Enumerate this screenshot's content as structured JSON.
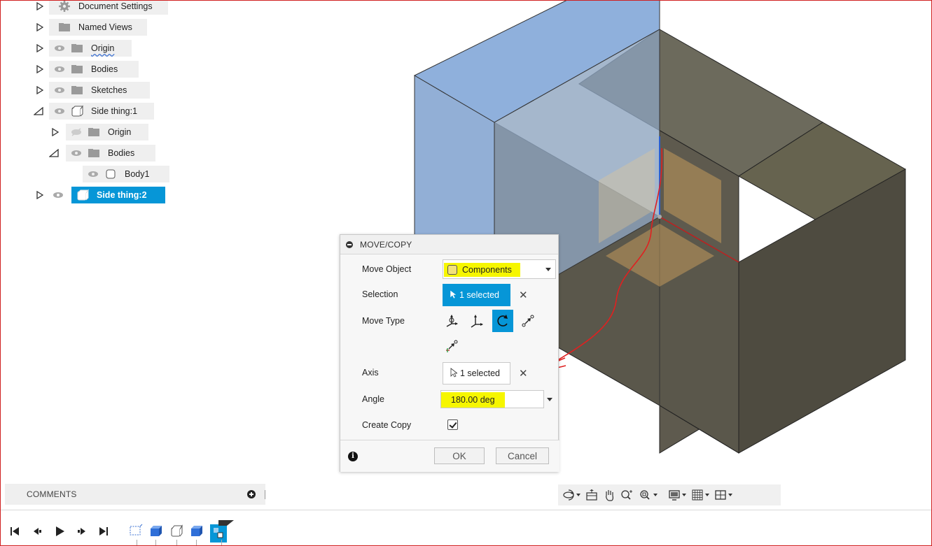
{
  "browser": {
    "items": [
      {
        "label": "Document Settings",
        "icon": "gear-icon"
      },
      {
        "label": "Named Views",
        "icon": "folder-icon"
      },
      {
        "label": "Origin",
        "icon": "folder-icon"
      },
      {
        "label": "Bodies",
        "icon": "folder-icon"
      },
      {
        "label": "Sketches",
        "icon": "folder-icon"
      },
      {
        "label": "Side thing:1",
        "icon": "component-icon"
      },
      {
        "label": "Origin",
        "icon": "folder-icon"
      },
      {
        "label": "Bodies",
        "icon": "folder-icon"
      },
      {
        "label": "Body1",
        "icon": "body-icon"
      },
      {
        "label": "Side thing:2",
        "icon": "component-icon",
        "selected": true
      }
    ]
  },
  "dialog": {
    "title": "MOVE/COPY",
    "move_object_label": "Move Object",
    "move_object_value": "Components",
    "selection_label": "Selection",
    "selection_value": "1 selected",
    "move_type_label": "Move Type",
    "axis_label": "Axis",
    "axis_value": "1 selected",
    "angle_label": "Angle",
    "angle_value": "180.00 deg",
    "create_copy_label": "Create Copy",
    "create_copy_checked": true,
    "ok_label": "OK",
    "cancel_label": "Cancel"
  },
  "comments": {
    "label": "COMMENTS"
  },
  "colors": {
    "accent": "#0696d7",
    "highlight": "#f6f600",
    "annotation": "#e02020",
    "body_dark": "#5e5a4e",
    "body_blue": "#8fb0dc"
  }
}
